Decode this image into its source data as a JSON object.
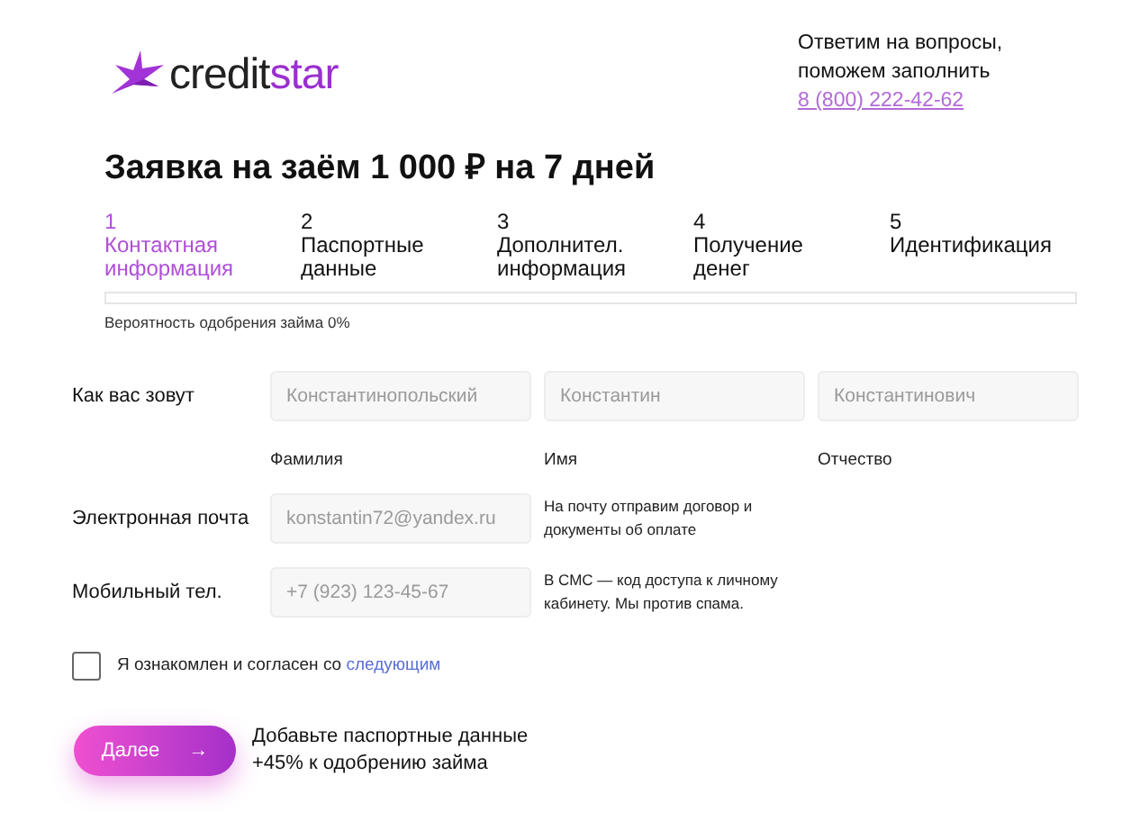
{
  "header": {
    "logo_text": "creditstar",
    "help_text": "Ответим на вопросы, поможем заполнить",
    "phone": "8 (800) 222-42-62"
  },
  "title": "Заявка на заём 1 000 ₽ на 7 дней",
  "steps": [
    {
      "number": "1",
      "label": "Контактная информация",
      "selected": true
    },
    {
      "number": "2",
      "label": "Паспортные данные",
      "selected": false
    },
    {
      "number": "3",
      "label": "Дополнител. информация",
      "selected": false
    },
    {
      "number": "4",
      "label": "Получение денег",
      "selected": false
    },
    {
      "number": "5",
      "label": "Идентификация",
      "selected": false
    }
  ],
  "progress": {
    "level": 0,
    "caption": "Вероятность одобрения займа 0%"
  },
  "form": {
    "name_row": {
      "label": "Как вас зовут",
      "fields": [
        {
          "placeholder": "Константинопольский",
          "caption": "Фамилия"
        },
        {
          "placeholder": "Константин",
          "caption": "Имя"
        },
        {
          "placeholder": "Константинович",
          "caption": "Отчество"
        }
      ]
    },
    "email_row": {
      "label": "Электронная почта",
      "placeholder": "konstantin72@yandex.ru",
      "hint": "На почту отправим договор и документы об оплате"
    },
    "phone_row": {
      "label": "Мобильный тел.",
      "placeholder": "+7 (923) 123-45-67",
      "hint": "В СМС — код доступа к личному кабинету. Мы против спама."
    }
  },
  "agreement": {
    "checked": false,
    "text": "Я ознакомлен и согласен со",
    "link": "следующим"
  },
  "next_button": {
    "label": "Далее",
    "arrow": "→"
  },
  "promo": {
    "line_1": "Добавьте паспортные данные",
    "line_2": "+45% к одобрению займа"
  }
}
